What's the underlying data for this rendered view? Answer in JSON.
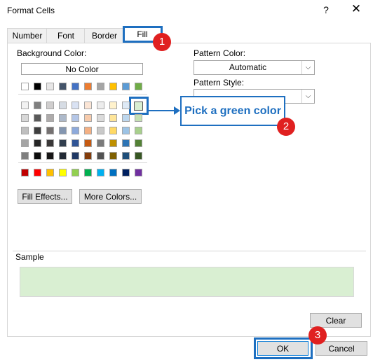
{
  "window": {
    "title": "Format Cells",
    "help_label": "?",
    "close_label": "✕"
  },
  "tabs": [
    {
      "label": "Number"
    },
    {
      "label": "Font"
    },
    {
      "label": "Border"
    },
    {
      "label": "Fill"
    }
  ],
  "fill": {
    "background_color_label": "Background Color:",
    "no_color_label": "No Color",
    "fill_effects_label": "Fill Effects...",
    "more_colors_label": "More Colors...",
    "pattern_color_label": "Pattern Color:",
    "pattern_color_value": "Automatic",
    "pattern_style_label": "Pattern Style:",
    "pattern_style_value": "",
    "selected_color": "#d9efd2",
    "palette_top": [
      "#ffffff",
      "#000000",
      "#e7e6e6",
      "#44546a",
      "#4472c4",
      "#ed7d31",
      "#a5a5a5",
      "#ffc000",
      "#5b9bd5",
      "#70ad47"
    ],
    "palette_tints": [
      [
        "#f2f2f2",
        "#7f7f7f",
        "#d0cece",
        "#d6dce4",
        "#d9e2f3",
        "#fbe5d5",
        "#ededed",
        "#fff2cc",
        "#deeaf6",
        "#e2efd9"
      ],
      [
        "#d8d8d8",
        "#595959",
        "#aeabab",
        "#adb9ca",
        "#b4c6e7",
        "#f7cbac",
        "#dbdbdb",
        "#fee599",
        "#bdd7ee",
        "#c5e0b3"
      ],
      [
        "#bfbfbf",
        "#3f3f3f",
        "#757171",
        "#8496b0",
        "#8eaadb",
        "#f4b083",
        "#c9c9c9",
        "#ffd965",
        "#9cc3e5",
        "#a8d08d"
      ],
      [
        "#a5a5a5",
        "#262626",
        "#3a3838",
        "#323f4f",
        "#2f5496",
        "#c55a11",
        "#7b7b7b",
        "#bf9000",
        "#2e75b5",
        "#538135"
      ],
      [
        "#7f7f7f",
        "#0c0c0c",
        "#171616",
        "#222a35",
        "#1f3864",
        "#833c0b",
        "#525252",
        "#7f6000",
        "#1e4e79",
        "#375623"
      ]
    ],
    "palette_standard": [
      "#c00000",
      "#ff0000",
      "#ffc000",
      "#ffff00",
      "#92d050",
      "#00b050",
      "#00b0f0",
      "#0070c0",
      "#002060",
      "#7030a0"
    ]
  },
  "sample": {
    "label": "Sample",
    "color": "#d9efd2"
  },
  "buttons": {
    "clear_label": "Clear",
    "ok_label": "OK",
    "cancel_label": "Cancel"
  },
  "annotations": {
    "step1": "1",
    "step2": "2",
    "step3": "3",
    "callout_text": "Pick a green color",
    "accent_color": "#1e6fc0",
    "badge_color": "#e02020"
  }
}
